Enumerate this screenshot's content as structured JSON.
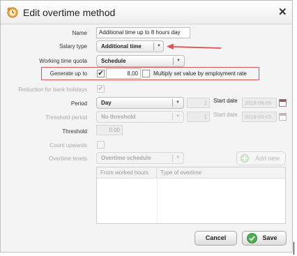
{
  "window": {
    "title": "Edit overtime method",
    "close_glyph": "✕"
  },
  "form": {
    "name": {
      "label": "Name",
      "value": "Additional time up to 8 hours day"
    },
    "salary_type": {
      "label": "Salary type",
      "value": "Additional time"
    },
    "working_time_quota": {
      "label": "Working time quota",
      "value": "Schedule"
    },
    "generate_up_to": {
      "label": "Generate up to",
      "checked": "✔",
      "value": "8,00",
      "multiply_label": "Multiply set value by employment rate"
    },
    "reduction_bank_holidays": {
      "label": "Reduction for bank holidays",
      "checked": "✔"
    },
    "period": {
      "label": "Period",
      "value": "Day",
      "count": "1",
      "start_date_label": "Start date",
      "start_date": "2018-06-05"
    },
    "threshold_period": {
      "label": "Threshold period",
      "value": "No threshold",
      "count": "1",
      "start_date_label": "Start date",
      "start_date": "2018-06-05"
    },
    "threshold": {
      "label": "Threshold",
      "value": "0.00"
    },
    "count_upwards": {
      "label": "Count upwards"
    },
    "overtime_levels": {
      "label": "Overtime levels",
      "value": "Overtime schedule",
      "add_new": "Add new"
    }
  },
  "grid": {
    "columns": [
      "From worked hours",
      "Type of overtime"
    ],
    "rows": []
  },
  "buttons": {
    "cancel": "Cancel",
    "save": "Save"
  },
  "colors": {
    "annotation": "#d9534f",
    "save_check": "#4caf50"
  }
}
